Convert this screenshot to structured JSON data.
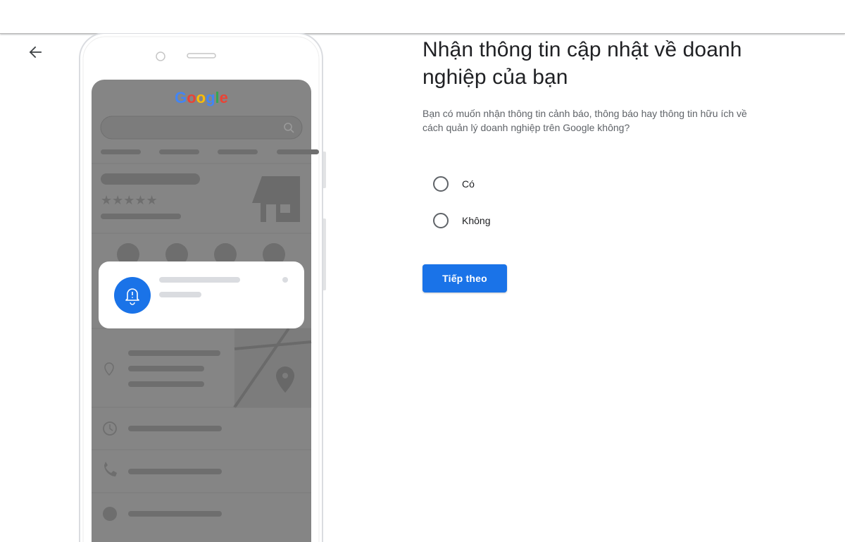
{
  "header": {},
  "navigation": {
    "back_icon": "arrow-back-icon"
  },
  "illustration": {
    "logo_text": "Google",
    "logo_colors": [
      "#4285f4",
      "#ea4335",
      "#fbbc05",
      "#4285f4",
      "#34a853",
      "#ea4335"
    ],
    "notification_icon": "bell-alert-icon",
    "accent_color": "#1a73e8"
  },
  "main": {
    "title": "Nhận thông tin cập nhật về doanh nghiệp của bạn",
    "description": "Bạn có muốn nhận thông tin cảnh báo, thông báo hay thông tin hữu ích về cách quản lý doanh nghiệp trên Google không?",
    "options": [
      {
        "label": "Có",
        "selected": false
      },
      {
        "label": "Không",
        "selected": false
      }
    ],
    "next_button_label": "Tiếp theo",
    "button_color": "#1a73e8"
  }
}
